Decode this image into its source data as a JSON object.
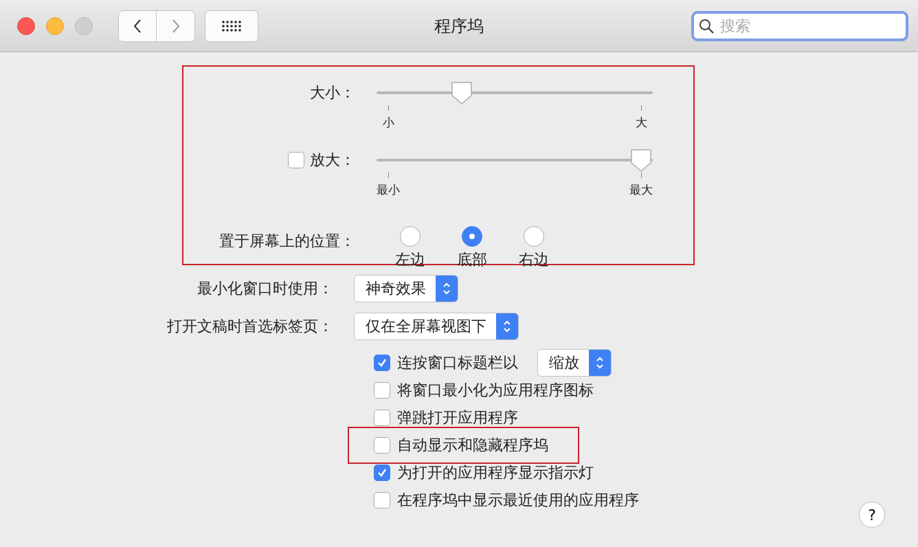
{
  "window": {
    "title": "程序坞"
  },
  "search": {
    "placeholder": "搜索"
  },
  "highlighted_section": {
    "highlighted": true,
    "sliders": [
      {
        "label": "大小：",
        "level": 0.29,
        "min_label": "小",
        "max_label": "大"
      },
      {
        "label": "放大：",
        "checked": false,
        "level": 1,
        "min_label": "最小",
        "max_label": "最大"
      }
    ],
    "position": {
      "label": "置于屏幕上的位置：",
      "options": [
        {
          "label": "左边",
          "selected": false
        },
        {
          "label": "底部",
          "selected": true
        },
        {
          "label": "右边",
          "selected": false
        }
      ]
    }
  },
  "popups": [
    {
      "label": "最小化窗口时使用：",
      "value": "神奇效果"
    },
    {
      "label": "打开文稿时首选标签页：",
      "value": "仅在全屏幕视图下"
    }
  ],
  "checkboxes": [
    {
      "label": "连按窗口标题栏以",
      "checked": true,
      "popup": "缩放"
    },
    {
      "label": "将窗口最小化为应用程序图标",
      "checked": false
    },
    {
      "label": "弹跳打开应用程序",
      "checked": false
    },
    {
      "label": "自动显示和隐藏程序坞",
      "checked": false,
      "highlighted": true
    },
    {
      "label": "为打开的应用程序显示指示灯",
      "checked": true
    },
    {
      "label": "在程序坞中显示最近使用的应用程序",
      "checked": false
    }
  ],
  "help_button": "?"
}
